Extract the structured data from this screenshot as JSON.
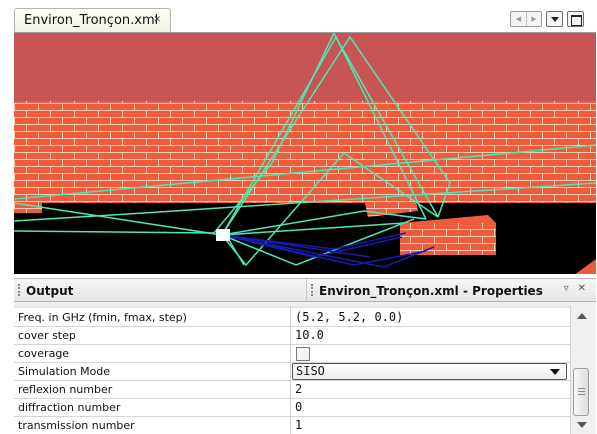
{
  "editor": {
    "tab_label": "Environ_Tronçon.xml",
    "tab_close_glyph": "✕",
    "nav_prev_icon": "◀",
    "nav_next_icon": "▶"
  },
  "scene": {
    "colors": {
      "wall": "#c95454",
      "brick": "#ee5b3d",
      "mortar": "#f9c9b3",
      "ground": "#000000",
      "ray_direct": "#4ce8b4",
      "ray_reflected": "#1a1ab0",
      "antenna": "#ffffff"
    }
  },
  "panel": {
    "output_tab": "Output",
    "properties_tab": "Environ_Tronçon.xml - Properties",
    "minimize_glyph": "▿",
    "close_glyph": "✕"
  },
  "properties": [
    {
      "name": "Freq. in GHz (fmin, fmax, step)",
      "value": "(5.2, 5.2, 0.0)"
    },
    {
      "name": "cover step",
      "value": "10.0"
    },
    {
      "name": "coverage",
      "value": ""
    },
    {
      "name": "Simulation Mode",
      "value": "SISO"
    },
    {
      "name": "reflexion number",
      "value": "2"
    },
    {
      "name": "diffraction number",
      "value": "0"
    },
    {
      "name": "transmission number",
      "value": "1"
    }
  ]
}
